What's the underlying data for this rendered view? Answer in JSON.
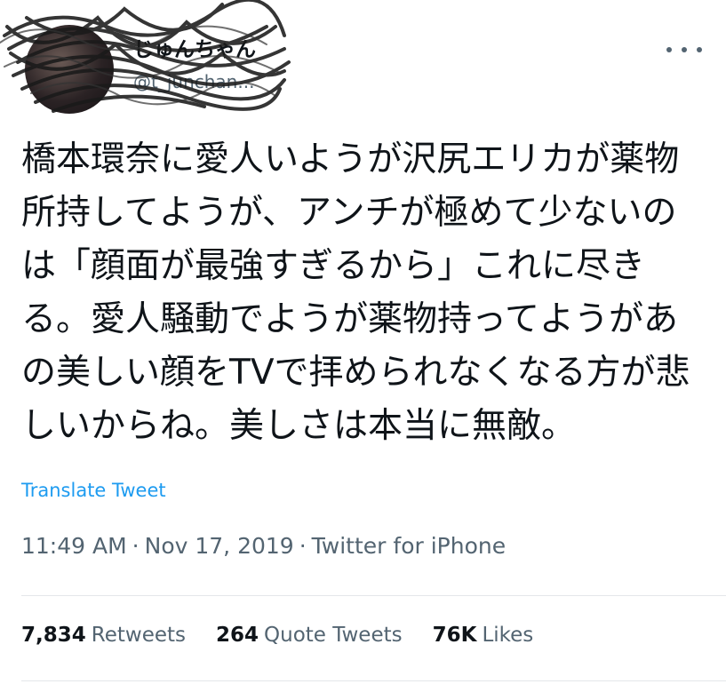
{
  "author": {
    "display_name": "じゅんちゃん",
    "handle": "@t_junchan..."
  },
  "tweet": {
    "text": "橋本環奈に愛人いようが沢尻エリカが薬物所持してようが、アンチが極めて少ないのは「顔面が最強すぎるから」これに尽きる。愛人騒動でようが薬物持ってようがあの美しい顔をTVで拝められなくなる方が悲しいからね。美しさは本当に無敵。",
    "translate_label": "Translate Tweet",
    "time": "11:49 AM",
    "date": "Nov 17, 2019",
    "source": "Twitter for iPhone",
    "separator": "·"
  },
  "stats": {
    "retweets": {
      "count": "7,834",
      "label": "Retweets"
    },
    "quotes": {
      "count": "264",
      "label": "Quote Tweets"
    },
    "likes": {
      "count": "76K",
      "label": "Likes"
    }
  },
  "icons": {
    "more": "more-horizontal-icon",
    "avatar": "avatar"
  }
}
